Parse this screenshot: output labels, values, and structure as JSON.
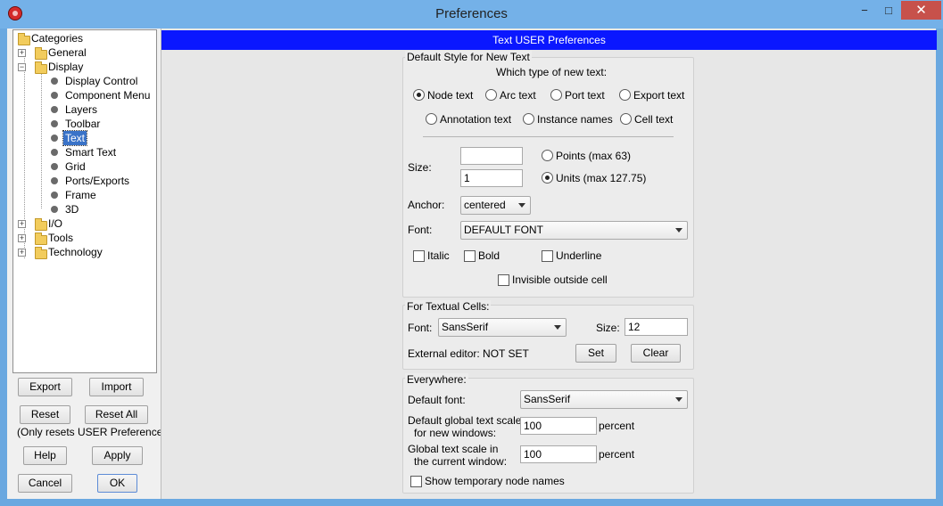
{
  "window": {
    "title": "Preferences",
    "minimize": "−",
    "maximize": "□",
    "close": "✕"
  },
  "tree": {
    "root": "Categories",
    "items": [
      {
        "label": "General",
        "expander": "+"
      },
      {
        "label": "Display",
        "expander": "−"
      },
      {
        "label": "Display Control"
      },
      {
        "label": "Component Menu"
      },
      {
        "label": "Layers"
      },
      {
        "label": "Toolbar"
      },
      {
        "label": "Text",
        "selected": true
      },
      {
        "label": "Smart Text"
      },
      {
        "label": "Grid"
      },
      {
        "label": "Ports/Exports"
      },
      {
        "label": "Frame"
      },
      {
        "label": "3D"
      },
      {
        "label": "I/O",
        "expander": "+"
      },
      {
        "label": "Tools",
        "expander": "+"
      },
      {
        "label": "Technology",
        "expander": "+"
      }
    ]
  },
  "buttons": {
    "export": "Export",
    "import": "Import",
    "reset": "Reset",
    "reset_all": "Reset All",
    "reset_note": "(Only resets USER Preferences)",
    "help": "Help",
    "apply": "Apply",
    "cancel": "Cancel",
    "ok": "OK"
  },
  "panel": {
    "header": "Text USER Preferences",
    "default_style": {
      "title": "Default Style for New Text",
      "which_type": "Which type of new text:",
      "types": [
        "Node text",
        "Arc text",
        "Port text",
        "Export text",
        "Annotation text",
        "Instance names",
        "Cell text"
      ],
      "selected_type": "Node text",
      "size_label": "Size:",
      "points_value": "",
      "units_value": "1",
      "points_label": "Points (max 63)",
      "units_label": "Units (max 127.75)",
      "size_mode": "Units",
      "anchor_label": "Anchor:",
      "anchor_value": "centered",
      "font_label": "Font:",
      "font_value": "DEFAULT FONT",
      "italic": "Italic",
      "bold": "Bold",
      "underline": "Underline",
      "invisible": "Invisible outside cell"
    },
    "textual_cells": {
      "title": "For Textual Cells:",
      "font_label": "Font:",
      "font_value": "SansSerif",
      "size_label": "Size:",
      "size_value": "12",
      "editor_label": "External editor: NOT SET",
      "set": "Set",
      "clear": "Clear"
    },
    "everywhere": {
      "title": "Everywhere:",
      "default_font_label": "Default font:",
      "default_font_value": "SansSerif",
      "scale_new_label_1": "Default global text scale",
      "scale_new_label_2": "for new windows:",
      "scale_new_value": "100",
      "scale_cur_label_1": "Global text scale in",
      "scale_cur_label_2": "the current window:",
      "scale_cur_value": "100",
      "percent": "percent",
      "show_temp": "Show temporary node names"
    }
  },
  "colors": {
    "header_band": "#0a17ff",
    "selection": "#3a73c8",
    "titlebar": "#74b1e8",
    "close": "#c7514b"
  }
}
